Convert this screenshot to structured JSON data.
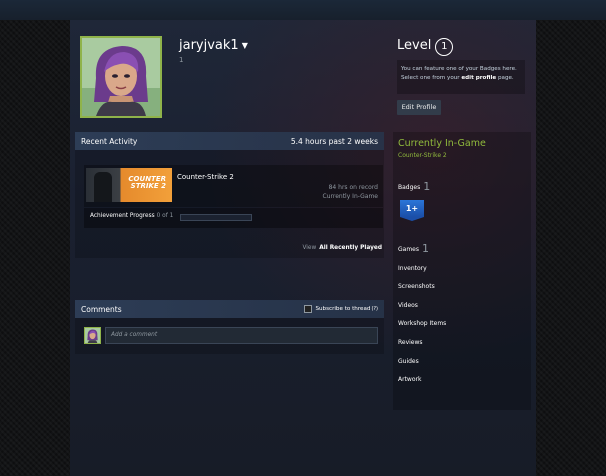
{
  "profile": {
    "persona_name": "jaryjvak1",
    "sub_line": "1",
    "level_label": "Level",
    "level_value": "1",
    "badge_note_line1": "You can feature one of your Badges here.",
    "badge_note_line2_pre": "Select one from your ",
    "badge_note_link": "edit profile",
    "badge_note_line2_post": " page.",
    "edit_profile_label": "Edit Profile"
  },
  "recent_activity": {
    "title": "Recent Activity",
    "summary": "5.4 hours past 2 weeks",
    "game": {
      "name": "Counter-Strike 2",
      "capsule_text_1": "COUNTER",
      "capsule_text_2": "STRIKE 2",
      "hours_on_record": "84 hrs on record",
      "status": "Currently In-Game",
      "achievement_label": "Achievement Progress",
      "achievement_count": "0 of 1",
      "achievement_progress": 0
    },
    "view_prefix": "View",
    "view_link": "All Recently Played"
  },
  "comments": {
    "title": "Comments",
    "subscribe_label": "Subscribe to thread",
    "subscribe_help": "(?)",
    "placeholder": "Add a comment"
  },
  "sidebar": {
    "ingame_title": "Currently In-Game",
    "ingame_game": "Counter-Strike 2",
    "badges_label": "Badges",
    "badges_count": "1",
    "badge_icon_text": "1+",
    "games_label": "Games",
    "games_count": "1",
    "links": [
      "Inventory",
      "Screenshots",
      "Videos",
      "Workshop Items",
      "Reviews",
      "Guides",
      "Artwork"
    ]
  },
  "colors": {
    "accent_green": "#90ba3c",
    "avatar_frame": "#8fb34a",
    "badge_blue": "#2b75d8"
  }
}
